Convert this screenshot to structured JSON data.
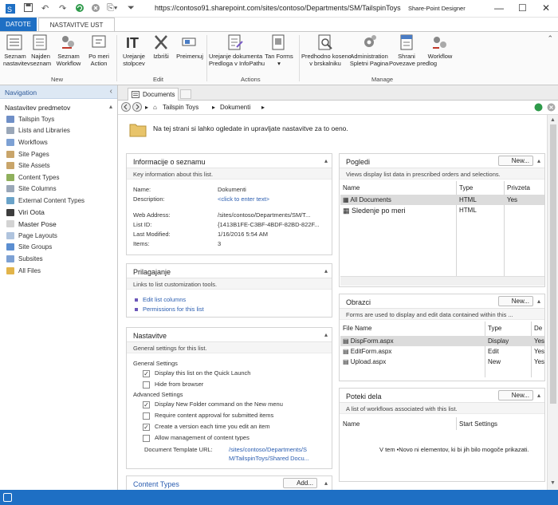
{
  "titlebar": {
    "url": "https://contoso91.sharepoint.com/sites/contoso/Departments/SM/TailspinToys",
    "app_name": "Share-Point Designer",
    "minimize": "—",
    "maximize": "☐",
    "close": "✕"
  },
  "ribbon": {
    "file_tab": "DATOTE",
    "active_tab": "NASTAVITVE UST",
    "buttons": {
      "list_settings_label": "Seznam\nnastavitev",
      "find_label": "Najden\nseznam",
      "list_workflow_label": "Seznam\nWorkflow",
      "custom_action_label": "Po meri\nAction",
      "edit_columns_label": "Urejanje\nstolpcev",
      "delete_label": "Izbriši",
      "rename_label": "Preimenuj",
      "edit_infopath_label": "Urejanje dokumenta\nPredloga v InfoPathu",
      "forms_label": "Tan Forms\n▾",
      "preview_browser_label": "Predhodno koseno\nv brskalniku",
      "administration_label": "Administration\nSpletni Pagina",
      "save_template_label": "Shrani\nPovezave predlog",
      "workflow_label": "Workflow"
    },
    "groups": {
      "new": "New",
      "edit": "Edit",
      "actions": "Actions",
      "manage": "Manage"
    }
  },
  "nav": {
    "header": "Navigation",
    "section": "Nastavitev predmetov",
    "items": [
      {
        "label": "Tailspin Toys",
        "color": "#6f8fc7"
      },
      {
        "label": "Lists and Libraries",
        "color": "#9aa7b8"
      },
      {
        "label": "Workflows",
        "color": "#7da1d4"
      },
      {
        "label": "Site Pages",
        "color": "#c9a56a"
      },
      {
        "label": "Site Assets",
        "color": "#c9a56a"
      },
      {
        "label": "Content Types",
        "color": "#8fb05c"
      },
      {
        "label": "Site Columns",
        "color": "#9aa7b8"
      },
      {
        "label": "External Content Types",
        "color": "#6aa3c9"
      },
      {
        "label": "Viri Oota",
        "color": "#3d3d3d"
      },
      {
        "label": "Master Pose",
        "color": "#d3d3d3"
      },
      {
        "label": "Page Layouts",
        "color": "#b0c4de"
      },
      {
        "label": "Site Groups",
        "color": "#5b8ed1"
      },
      {
        "label": "Subsites",
        "color": "#7da1d4"
      },
      {
        "label": "All Files",
        "color": "#e2b44a"
      }
    ]
  },
  "doc": {
    "tab_label": "Documents",
    "breadcrumb": [
      "Tailspin Toys",
      "Dokumenti"
    ],
    "banner": "Na tej strani si lahko ogledate in upravljate nastavitve za to oeno."
  },
  "info_panel": {
    "title": "Informacije o seznamu",
    "desc": "Key information about this list.",
    "name_label": "Name:",
    "name_value": "Dokumenti",
    "description_label": "Description:",
    "description_value": "<click to enter text>",
    "web_label": "Web Address:",
    "web_value": "/sites/contoso/Departments/SM/T...",
    "listid_label": "List ID:",
    "listid_value": "{1413B1FE-C3BF-4BDF-82BD-822F...",
    "modified_label": "Last Modified:",
    "modified_value": "1/16/2016 5:54 AM",
    "items_label": "Items:",
    "items_value": "3"
  },
  "custom_panel": {
    "title": "Prilagajanje",
    "desc": "Links to list customization tools.",
    "links": [
      "Edit list columns",
      "Permissions for this list"
    ]
  },
  "settings_panel": {
    "title": "Nastavitve",
    "desc": "General settings for this list.",
    "general_head": "General Settings",
    "quick_launch": "Display this list on the Quick Launch",
    "hide_browser": "Hide from browser",
    "advanced_head": "Advanced Settings",
    "new_folder": "Display New Folder command on the New menu",
    "approval": "Require content approval for submitted items",
    "version": "Create a version each time you edit an item",
    "content_types": "Allow management of content types",
    "template_label": "Document Template URL:",
    "template_value_1": "/sites/contoso/Departments/S",
    "template_value_2": "M/TailspinToys/Shared Docu..."
  },
  "content_types_panel": {
    "title": "Content Types",
    "add": "Add..."
  },
  "views_panel": {
    "title": "Pogledi",
    "new_label": "New...",
    "desc": "Views display list data in prescribed orders and selections.",
    "cols": [
      "Name",
      "Type",
      "Privzeta"
    ],
    "rows": [
      {
        "name": "All Documents",
        "type": "HTML",
        "default": "Yes"
      },
      {
        "name": "Sledenje po meri",
        "type": "HTML",
        "default": ""
      }
    ]
  },
  "forms_panel": {
    "title": "Obrazci",
    "new_label": "New...",
    "desc": "Forms are used to display and edit data contained within this ...",
    "cols": [
      "File Name",
      "Type",
      "De"
    ],
    "rows": [
      {
        "name": "DispForm.aspx",
        "type": "Display",
        "default": "Yes"
      },
      {
        "name": "EditForm.aspx",
        "type": "Edit",
        "default": "Yes"
      },
      {
        "name": "Upload.aspx",
        "type": "New",
        "default": "Yes"
      }
    ]
  },
  "workflows_panel": {
    "title": "Poteki dela",
    "new_label": "New...",
    "desc": "A list of workflows associated with this list.",
    "cols": [
      "Name",
      "Start Settings"
    ],
    "empty": "V tem •Novo ni elementov, ki bi jih bilo mogoče prikazati."
  }
}
